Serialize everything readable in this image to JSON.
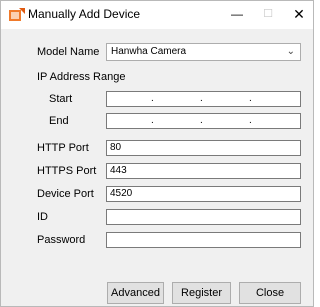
{
  "window": {
    "title": "Manually Add Device",
    "icon": "device-add-icon",
    "controls": {
      "minimize": "—",
      "maximize": "☐",
      "close": "✕"
    }
  },
  "form": {
    "model_name_label": "Model Name",
    "model_name_value": "Hanwha Camera",
    "ip_range_label": "IP Address Range",
    "start_label": "Start",
    "end_label": "End",
    "ip_separator": ".",
    "http_port_label": "HTTP Port",
    "http_port_value": "80",
    "https_port_label": "HTTPS Port",
    "https_port_value": "443",
    "device_port_label": "Device Port",
    "device_port_value": "4520",
    "id_label": "ID",
    "id_value": "",
    "password_label": "Password",
    "password_value": ""
  },
  "buttons": {
    "advanced": "Advanced",
    "register": "Register",
    "close": "Close"
  },
  "colors": {
    "dialog_bg": "#f0f0f0",
    "titlebar_bg": "#ffffff",
    "icon_orange": "#f07a2a"
  }
}
